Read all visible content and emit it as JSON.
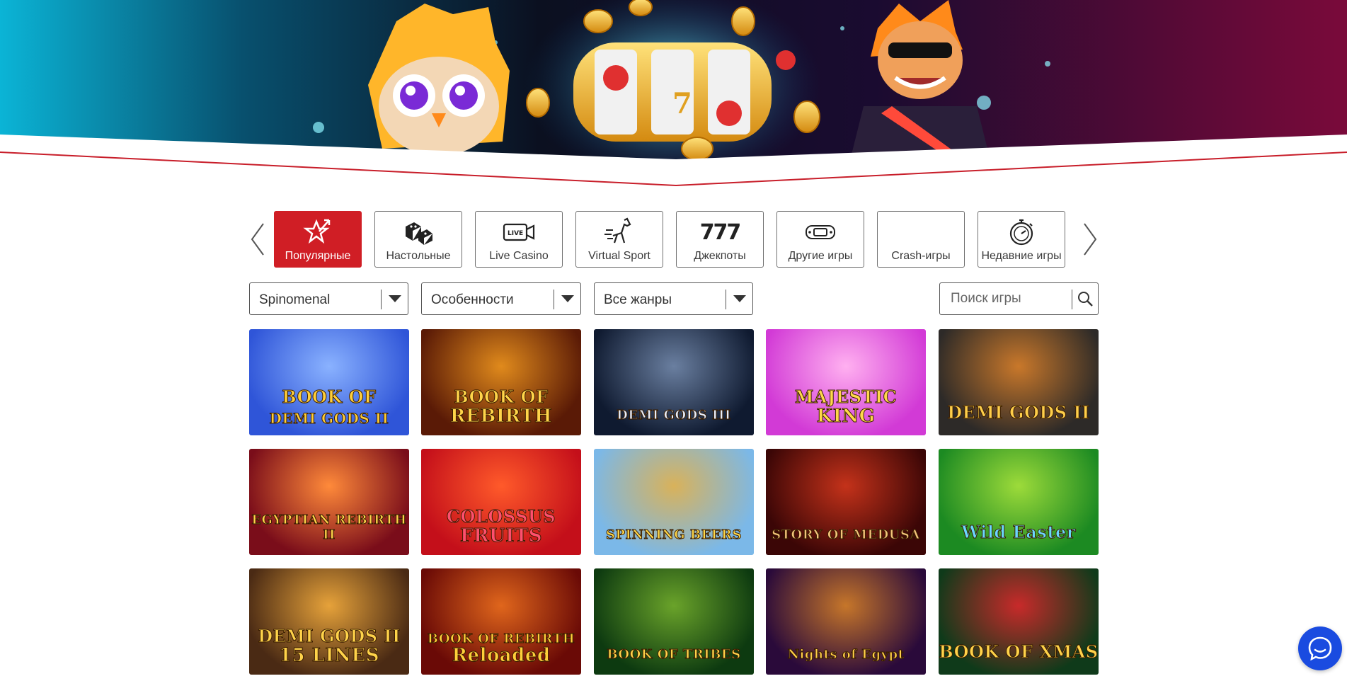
{
  "categories": {
    "prev_label": "‹",
    "next_label": "›",
    "items": [
      {
        "label": "Популярные",
        "icon": "star-arrow-icon",
        "active": true
      },
      {
        "label": "Настольные",
        "icon": "dice-icon",
        "active": false
      },
      {
        "label": "Live Casino",
        "icon": "live-camera-icon",
        "active": false
      },
      {
        "label": "Virtual Sport",
        "icon": "horse-icon",
        "active": false
      },
      {
        "label": "Джекпоты",
        "icon": "777-icon",
        "active": false
      },
      {
        "label": "Другие игры",
        "icon": "gamepad-icon",
        "active": false
      },
      {
        "label": "Crash-игры",
        "icon": "none",
        "active": false
      },
      {
        "label": "Недавние игры",
        "icon": "stopwatch-icon",
        "active": false
      }
    ],
    "icon_777": "777",
    "icon_live": "LIVE"
  },
  "filters": {
    "provider": "Spinomenal",
    "features": "Особенности",
    "genres": "Все жанры",
    "search_placeholder": "Поиск игры"
  },
  "games": [
    {
      "title": "BOOK OF",
      "title2": "DEMI GODS II",
      "bg1": "#2f55d8",
      "bg2": "#8ab2ff",
      "text": "#ffcf3a"
    },
    {
      "title": "BOOK OF",
      "title2": "REBIRTH",
      "bg1": "#5a1a06",
      "bg2": "#e08a1c",
      "text": "#ffd54a"
    },
    {
      "title": "DEMI GODS III",
      "title2": "",
      "bg1": "#0f1a30",
      "bg2": "#6a7fa0",
      "text": "#e8eefb"
    },
    {
      "title": "MAJESTIC",
      "title2": "KING",
      "bg1": "#d23ad6",
      "bg2": "#ffb0f0",
      "text": "#ffd84a"
    },
    {
      "title": "DEMI GODS II",
      "title2": "",
      "bg1": "#2d2a28",
      "bg2": "#c9782a",
      "text": "#ffcf4a"
    },
    {
      "title": "EGYPTIAN REBIRTH II",
      "title2": "",
      "bg1": "#7a0d1a",
      "bg2": "#ff8a3a",
      "text": "#ffd34a"
    },
    {
      "title": "COLOSSUS",
      "title2": "FRUITS",
      "bg1": "#c40f1a",
      "bg2": "#ff5a2a",
      "text": "#ff4f6e"
    },
    {
      "title": "SPINNING BEERS",
      "title2": "",
      "bg1": "#7bb8e8",
      "bg2": "#d9b25a",
      "text": "#ffd84a"
    },
    {
      "title": "STORY OF MEDUSA",
      "title2": "",
      "bg1": "#3b0606",
      "bg2": "#c4321a",
      "text": "#f3c47a"
    },
    {
      "title": "Wild Easter",
      "title2": "",
      "bg1": "#1c8a22",
      "bg2": "#9ddb3a",
      "text": "#6bd7ff"
    },
    {
      "title": "DEMI GODS II",
      "title2": "15 LINES",
      "bg1": "#4a2a14",
      "bg2": "#e6a23a",
      "text": "#ffd34a"
    },
    {
      "title": "BOOK OF REBIRTH",
      "title2": "Reloaded",
      "bg1": "#6a0a06",
      "bg2": "#e0661c",
      "text": "#ffcf3a"
    },
    {
      "title": "BOOK OF TRIBES",
      "title2": "",
      "bg1": "#0d3a10",
      "bg2": "#6aa32a",
      "text": "#ffd34a"
    },
    {
      "title": "Nights of Egypt",
      "title2": "",
      "bg1": "#2a0a3a",
      "bg2": "#c6762a",
      "text": "#ffcf4a"
    },
    {
      "title": "BOOK OF XMAS",
      "title2": "",
      "bg1": "#0f3a1a",
      "bg2": "#c82a2a",
      "text": "#ffd34a"
    }
  ],
  "colors": {
    "accent": "#d01e25",
    "chat": "#1a4be0"
  }
}
